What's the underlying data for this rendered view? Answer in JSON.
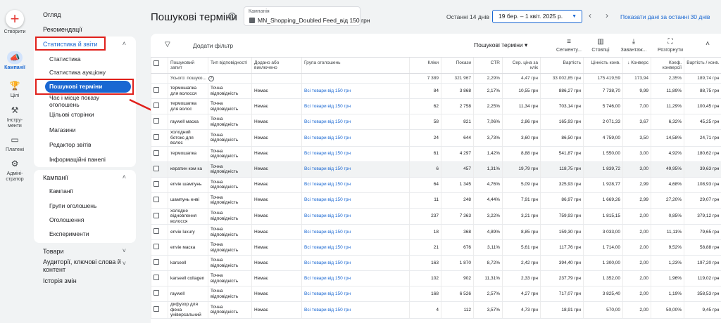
{
  "rail": {
    "create": "Створити",
    "campaigns": "Кампанії",
    "goals": "Цілі",
    "tools": "Інстру-\nменти",
    "billing": "Платежі",
    "admin": "Адміні-\nстратор"
  },
  "nav": {
    "overview": "Огляд",
    "recommendations": "Рекомендації",
    "insights": {
      "label": "Статистика й звіти",
      "items": [
        "Статистика",
        "Статистика аукціону",
        "Пошукові терміни",
        "Час і місце показу оголошень",
        "Цільові сторінки",
        "Магазини",
        "Редактор звітів",
        "Інформаційні панелі"
      ]
    },
    "campaigns": {
      "label": "Кампанії",
      "items": [
        "Кампанії",
        "Групи оголошень",
        "Оголошення",
        "Експерименти"
      ]
    },
    "products": "Товари",
    "audiences": "Аудиторії, ключові слова й контент",
    "change_history": "Історія змін"
  },
  "header": {
    "title": "Пошукові терміни",
    "campaign_label": "Кампанія",
    "campaign_value": "MN_Shopping_Doubled Feed_від 150 грн",
    "range_label": "Останні 14 днів",
    "date_range": "19 бер. – 1 квіт. 2025 р.",
    "show_last": "Показати дані за останні 30 днів"
  },
  "toolbar": {
    "add_filter": "Додати фільтр",
    "view": "Пошукові терміни",
    "segment": "Сегменту...",
    "columns": "Стовпці",
    "download": "Завантаж...",
    "expand": "Розгорнути"
  },
  "table": {
    "headers": [
      "Пошуковий запит",
      "Тип відповідності",
      "Додано або виключено",
      "Група оголошень",
      "Кліки",
      "Покази",
      "CTR",
      "Сер. ціна за клік",
      "Вартість",
      "Цінність конв.",
      "Конверс",
      "Коеф. конверсії",
      "Вартість / конв."
    ],
    "total": {
      "label": "Усього: пошуко...",
      "clicks": "7 389",
      "impr": "321 967",
      "ctr": "2,29%",
      "cpc": "4,47 грн",
      "cost": "33 002,85 грн",
      "value": "175 419,59",
      "conv": "173,94",
      "rate": "2,35%",
      "cpa": "189,74 грн"
    },
    "rows": [
      {
        "term": "термошапка для волосся",
        "match": "Точна відповідність",
        "added": "Немає",
        "group": "Всі товари від 150 грн",
        "clicks": "84",
        "impr": "3 868",
        "ctr": "2,17%",
        "cpc": "10,55 грн",
        "cost": "886,27 грн",
        "value": "7 738,70",
        "conv": "9,99",
        "rate": "11,89%",
        "cpa": "88,75 грн"
      },
      {
        "term": "термошапка для волос",
        "match": "Точна відповідність",
        "added": "Немає",
        "group": "Всі товари від 150 грн",
        "clicks": "62",
        "impr": "2 758",
        "ctr": "2,25%",
        "cpc": "11,34 грн",
        "cost": "703,14 грн",
        "value": "5 746,00",
        "conv": "7,00",
        "rate": "11,29%",
        "cpa": "100,45 грн"
      },
      {
        "term": "raywell маска",
        "match": "Точна відповідність",
        "added": "Немає",
        "group": "Всі товари від 150 грн",
        "clicks": "58",
        "impr": "821",
        "ctr": "7,06%",
        "cpc": "2,86 грн",
        "cost": "165,93 грн",
        "value": "2 071,33",
        "conv": "3,67",
        "rate": "6,32%",
        "cpa": "45,25 грн"
      },
      {
        "term": "холодний ботокс для волос",
        "match": "Точна відповідність",
        "added": "Немає",
        "group": "Всі товари від 150 грн",
        "clicks": "24",
        "impr": "644",
        "ctr": "3,73%",
        "cpc": "3,60 грн",
        "cost": "86,50 грн",
        "value": "4 759,00",
        "conv": "3,50",
        "rate": "14,58%",
        "cpa": "24,71 грн"
      },
      {
        "term": "термошапка",
        "match": "Точна відповідність",
        "added": "Немає",
        "group": "Всі товари від 150 грн",
        "clicks": "61",
        "impr": "4 297",
        "ctr": "1,42%",
        "cpc": "8,88 грн",
        "cost": "541,87 грн",
        "value": "1 550,00",
        "conv": "3,00",
        "rate": "4,92%",
        "cpa": "180,62 грн"
      },
      {
        "term": "кератин ком ка",
        "match": "Точна відповідність",
        "added": "Немає",
        "group": "Всі товари від 150 грн",
        "clicks": "6",
        "impr": "457",
        "ctr": "1,31%",
        "cpc": "19,79 грн",
        "cost": "118,75 грн",
        "value": "1 839,72",
        "conv": "3,00",
        "rate": "49,95%",
        "cpa": "39,63 грн"
      },
      {
        "term": "envie шампунь",
        "match": "Точна відповідність",
        "added": "Немає",
        "group": "Всі товари від 150 грн",
        "clicks": "64",
        "impr": "1 345",
        "ctr": "4,76%",
        "cpc": "5,09 грн",
        "cost": "325,93 грн",
        "value": "1 928,77",
        "conv": "2,99",
        "rate": "4,68%",
        "cpa": "108,93 грн"
      },
      {
        "term": "шампунь енві",
        "match": "Точна відповідність",
        "added": "Немає",
        "group": "Всі товари від 150 грн",
        "clicks": "11",
        "impr": "248",
        "ctr": "4,44%",
        "cpc": "7,91 грн",
        "cost": "86,97 грн",
        "value": "1 669,26",
        "conv": "2,99",
        "rate": "27,20%",
        "cpa": "29,07 грн"
      },
      {
        "term": "холодне відновлення волосся",
        "match": "Точна відповідність",
        "added": "Немає",
        "group": "Всі товари від 150 грн",
        "clicks": "237",
        "impr": "7 363",
        "ctr": "3,22%",
        "cpc": "3,21 грн",
        "cost": "759,93 грн",
        "value": "1 815,15",
        "conv": "2,00",
        "rate": "0,85%",
        "cpa": "379,12 грн"
      },
      {
        "term": "envie luxury",
        "match": "Точна відповідність",
        "added": "Немає",
        "group": "Всі товари від 150 грн",
        "clicks": "18",
        "impr": "368",
        "ctr": "4,89%",
        "cpc": "8,85 грн",
        "cost": "159,30 грн",
        "value": "3 033,00",
        "conv": "2,00",
        "rate": "11,11%",
        "cpa": "79,65 грн"
      },
      {
        "term": "envie маска",
        "match": "Точна відповідність",
        "added": "Немає",
        "group": "Всі товари від 150 грн",
        "clicks": "21",
        "impr": "676",
        "ctr": "3,11%",
        "cpc": "5,61 грн",
        "cost": "117,76 грн",
        "value": "1 714,00",
        "conv": "2,00",
        "rate": "9,52%",
        "cpa": "58,88 грн"
      },
      {
        "term": "karseell",
        "match": "Точна відповідність",
        "added": "Немає",
        "group": "Всі товари від 150 грн",
        "clicks": "163",
        "impr": "1 870",
        "ctr": "8,72%",
        "cpc": "2,42 грн",
        "cost": "394,40 грн",
        "value": "1 300,00",
        "conv": "2,00",
        "rate": "1,23%",
        "cpa": "197,20 грн"
      },
      {
        "term": "karseell collagen",
        "match": "Точна відповідність",
        "added": "Немає",
        "group": "Всі товари від 150 грн",
        "clicks": "102",
        "impr": "902",
        "ctr": "11,31%",
        "cpc": "2,33 грн",
        "cost": "237,79 грн",
        "value": "1 352,00",
        "conv": "2,00",
        "rate": "1,96%",
        "cpa": "119,02 грн"
      },
      {
        "term": "raywell",
        "match": "Точна відповідність",
        "added": "Немає",
        "group": "Всі товари від 150 грн",
        "clicks": "168",
        "impr": "6 526",
        "ctr": "2,57%",
        "cpc": "4,27 грн",
        "cost": "717,07 грн",
        "value": "3 825,40",
        "conv": "2,00",
        "rate": "1,19%",
        "cpa": "358,53 грн"
      },
      {
        "term": "дифузор для фена універсальний",
        "match": "Точна відповідність",
        "added": "Немає",
        "group": "Всі товари від 150 грн",
        "clicks": "4",
        "impr": "112",
        "ctr": "3,57%",
        "cpc": "4,73 грн",
        "cost": "18,91 грн",
        "value": "570,00",
        "conv": "2,00",
        "rate": "50,00%",
        "cpa": "9,45 грн"
      }
    ]
  },
  "colors": {
    "accent": "#1967d2",
    "highlight": "#e0201b"
  }
}
